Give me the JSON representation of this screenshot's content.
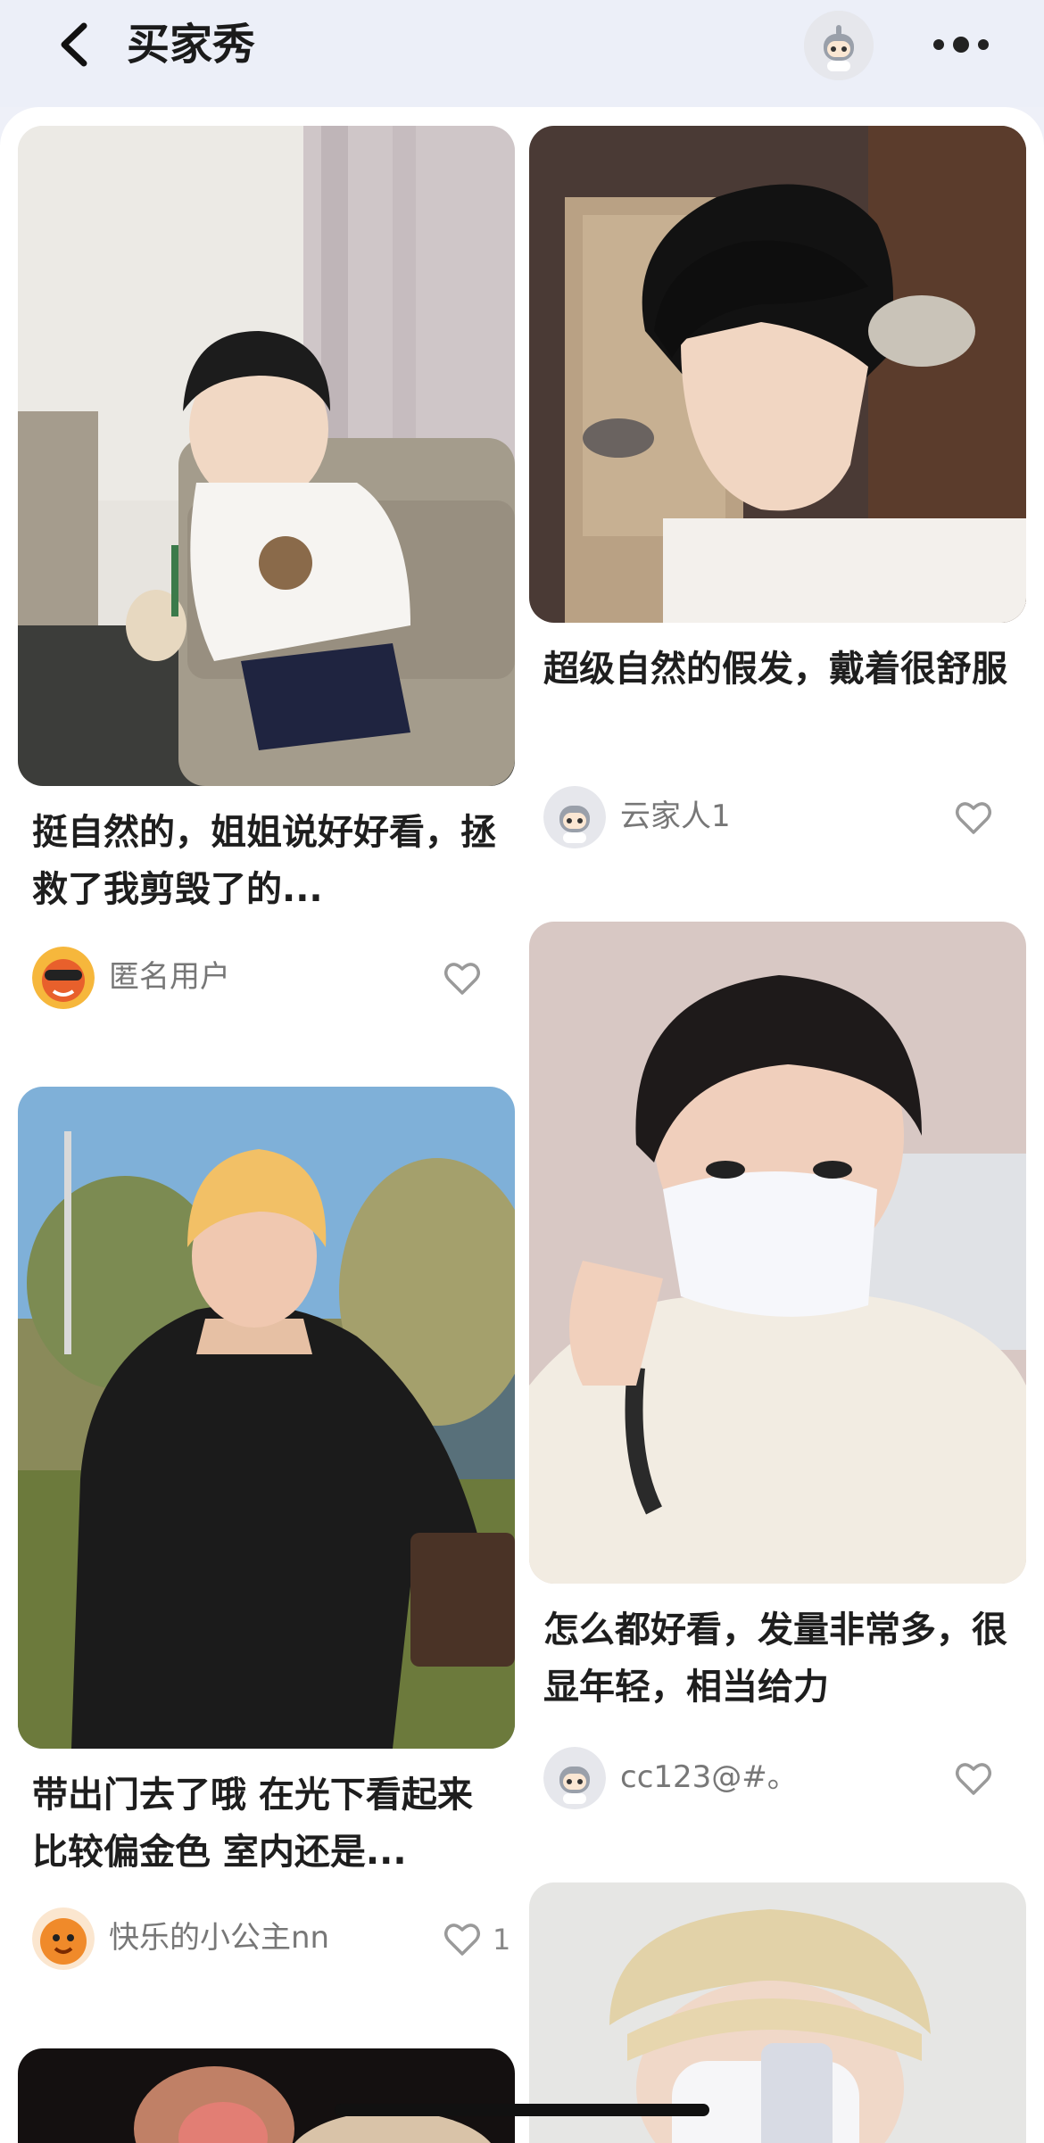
{
  "header": {
    "title": "买家秀"
  },
  "cards": [
    {
      "title": "挺自然的，姐姐说好好看，拯救了我剪毁了的...",
      "user": "匿名用户",
      "likes": ""
    },
    {
      "title": "超级自然的假发，戴着很舒服",
      "user": "云家人1",
      "likes": ""
    },
    {
      "title": "带出门去了哦 在光下看起来比较偏金色 室内还是...",
      "user": "快乐的小公主nn",
      "likes": "1"
    },
    {
      "title": "怎么都好看，发量非常多，很显年轻，相当给力",
      "user": "cc123@#。",
      "likes": ""
    }
  ],
  "colors": {
    "header_bg": "#eceff8",
    "panel_bg": "#ffffff",
    "title_text": "#1e1e1e",
    "muted_text": "#777777"
  },
  "icons": [
    "back-arrow-icon",
    "robot-avatar-icon",
    "more-dots-icon",
    "heart-icon"
  ]
}
